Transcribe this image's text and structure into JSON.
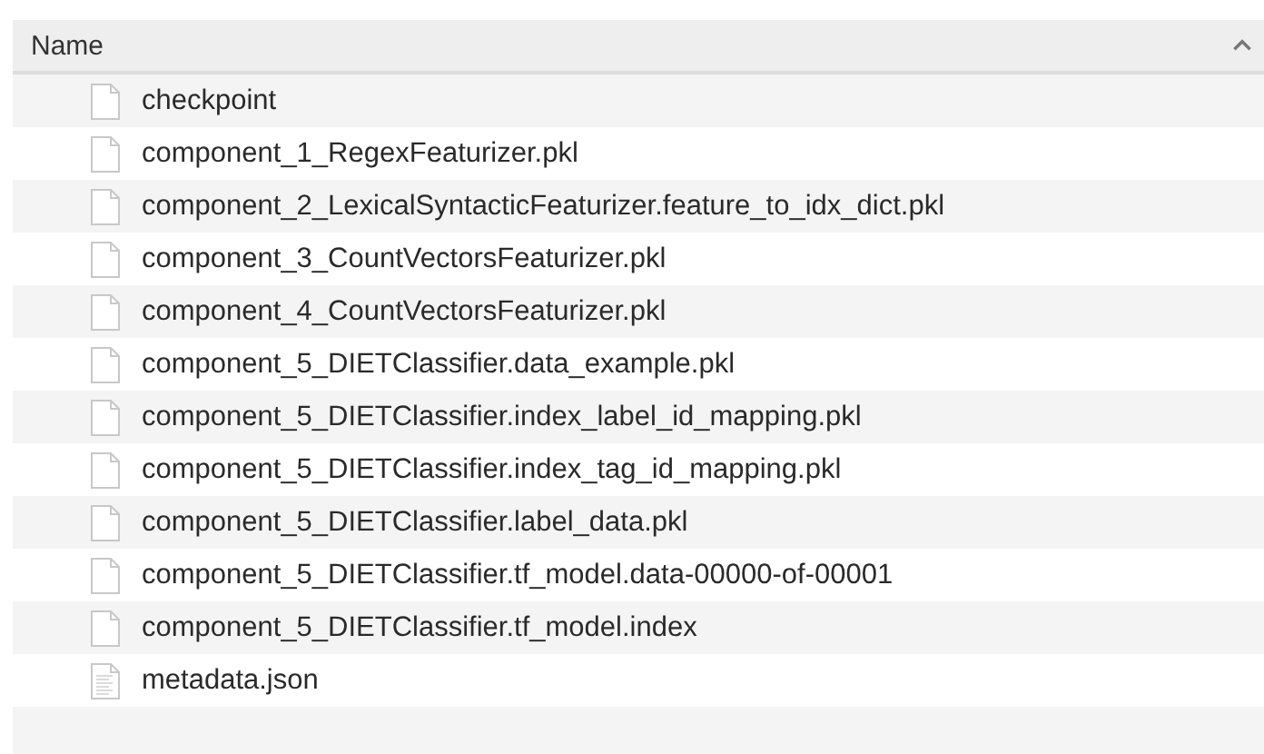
{
  "table": {
    "columns": [
      {
        "label": "Name",
        "sorted_ascending": true
      }
    ],
    "rows": [
      {
        "name": "checkpoint",
        "kind": "file"
      },
      {
        "name": "component_1_RegexFeaturizer.pkl",
        "kind": "file"
      },
      {
        "name": "component_2_LexicalSyntacticFeaturizer.feature_to_idx_dict.pkl",
        "kind": "file"
      },
      {
        "name": "component_3_CountVectorsFeaturizer.pkl",
        "kind": "file"
      },
      {
        "name": "component_4_CountVectorsFeaturizer.pkl",
        "kind": "file"
      },
      {
        "name": "component_5_DIETClassifier.data_example.pkl",
        "kind": "file"
      },
      {
        "name": "component_5_DIETClassifier.index_label_id_mapping.pkl",
        "kind": "file"
      },
      {
        "name": "component_5_DIETClassifier.index_tag_id_mapping.pkl",
        "kind": "file"
      },
      {
        "name": "component_5_DIETClassifier.label_data.pkl",
        "kind": "file"
      },
      {
        "name": "component_5_DIETClassifier.tf_model.data-00000-of-00001",
        "kind": "file"
      },
      {
        "name": "component_5_DIETClassifier.tf_model.index",
        "kind": "file"
      },
      {
        "name": "metadata.json",
        "kind": "text"
      }
    ]
  }
}
